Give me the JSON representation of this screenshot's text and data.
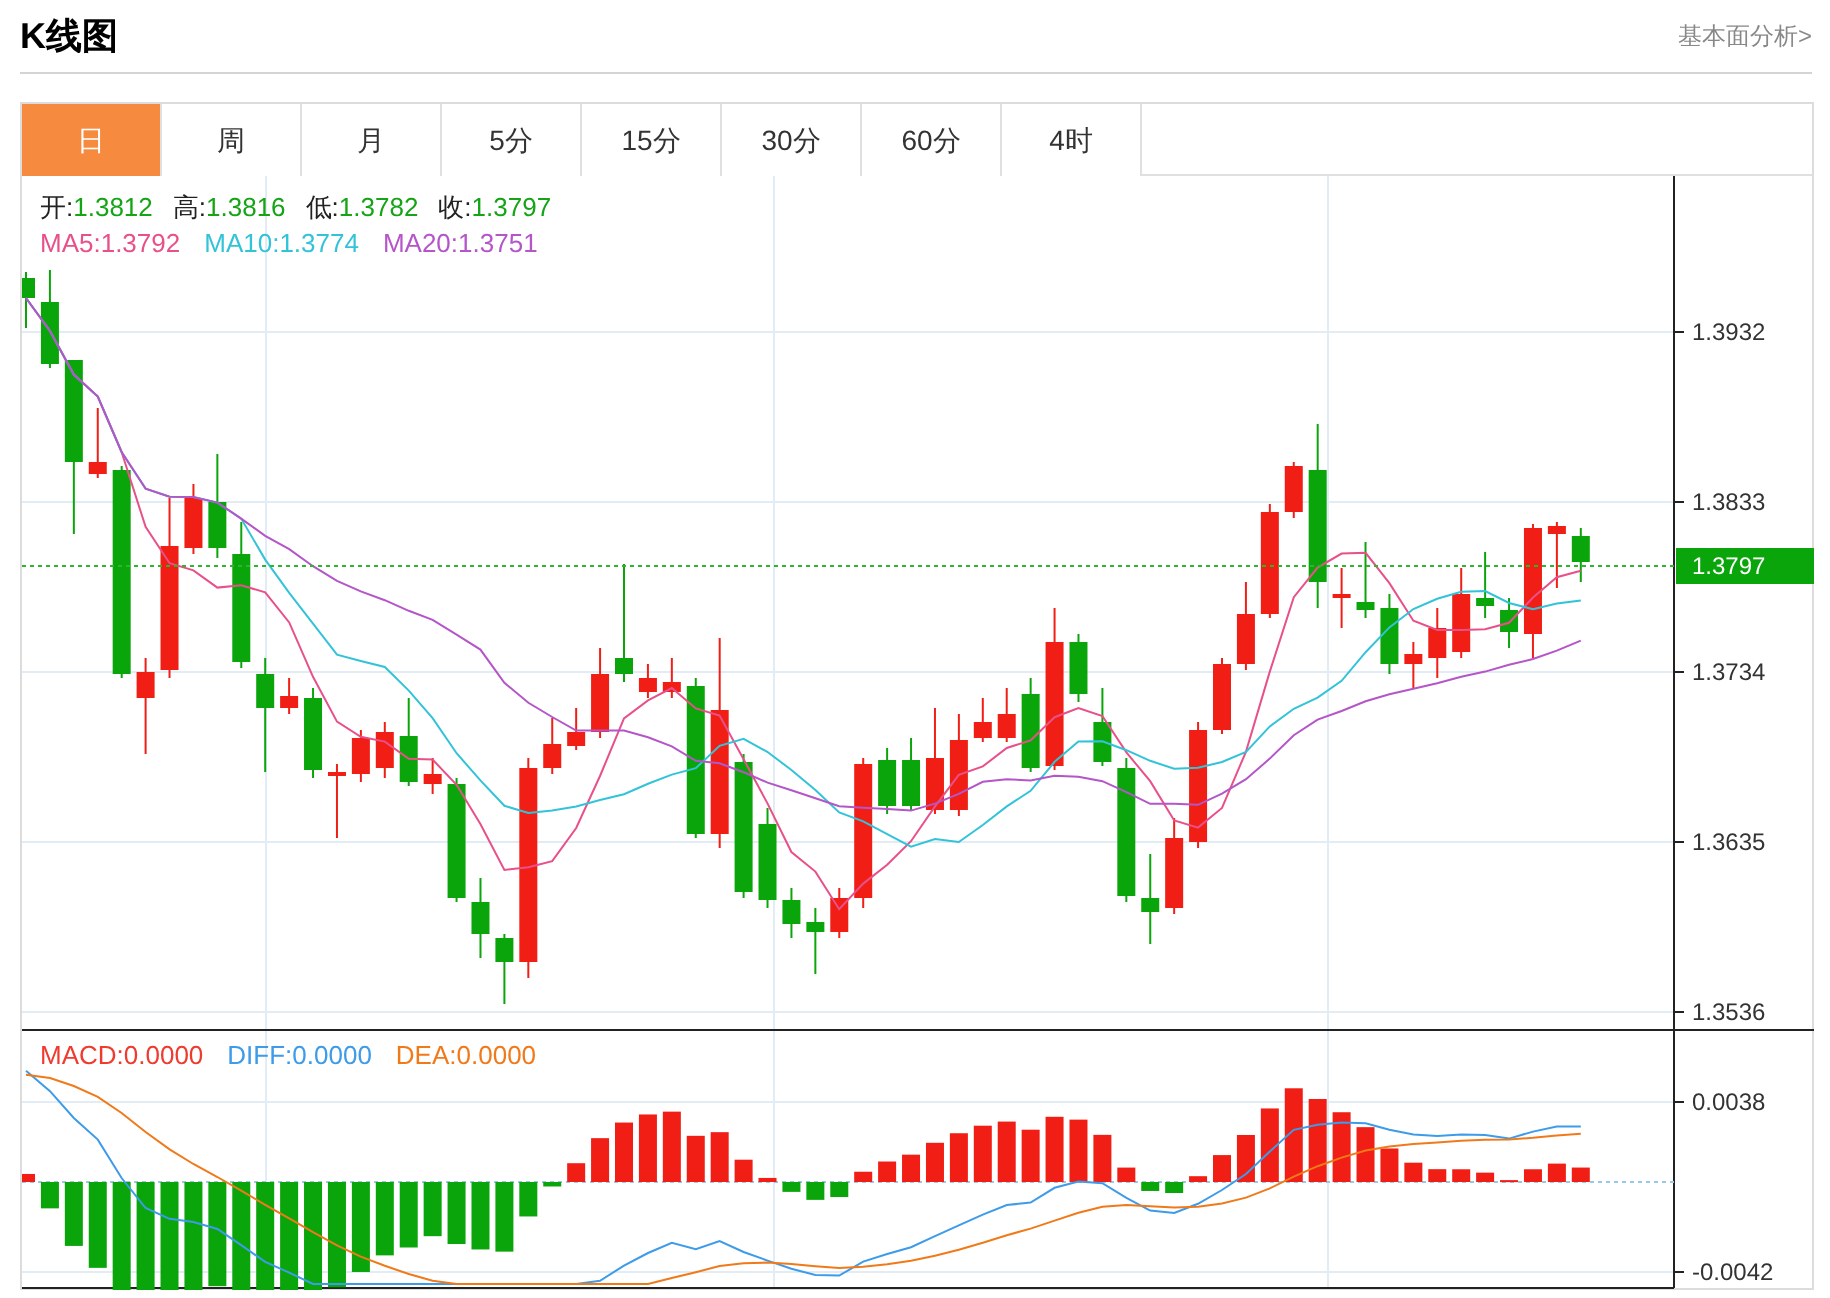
{
  "title": "K线图",
  "fundamental_link": "基本面分析>",
  "tabs": [
    {
      "label": "日",
      "selected": true
    },
    {
      "label": "周",
      "selected": false
    },
    {
      "label": "月",
      "selected": false
    },
    {
      "label": "5分",
      "selected": false
    },
    {
      "label": "15分",
      "selected": false
    },
    {
      "label": "30分",
      "selected": false
    },
    {
      "label": "60分",
      "selected": false
    },
    {
      "label": "4时",
      "selected": false
    }
  ],
  "ohlc": [
    {
      "label": "开:",
      "value": "1.3812"
    },
    {
      "label": "高:",
      "value": "1.3816"
    },
    {
      "label": "低:",
      "value": "1.3782"
    },
    {
      "label": "收:",
      "value": "1.3797"
    }
  ],
  "moving_averages": [
    {
      "label": "MA5:",
      "value": "1.3792",
      "color": "#e8508a"
    },
    {
      "label": "MA10:",
      "value": "1.3774",
      "color": "#33c3d8"
    },
    {
      "label": "MA20:",
      "value": "1.3751",
      "color": "#b455c8"
    }
  ],
  "price_axis": [
    "1.3932",
    "1.3833",
    "1.3734",
    "1.3635",
    "1.3536"
  ],
  "current_price": "1.3797",
  "macd_legend": [
    {
      "label": "MACD:",
      "value": "0.0000",
      "color": "#f03a2e"
    },
    {
      "label": "DIFF:",
      "value": "0.0000",
      "color": "#3d9be9"
    },
    {
      "label": "DEA:",
      "value": "0.0000",
      "color": "#f07a1a"
    }
  ],
  "macd_axis": [
    "0.0038",
    "-0.0042"
  ]
}
